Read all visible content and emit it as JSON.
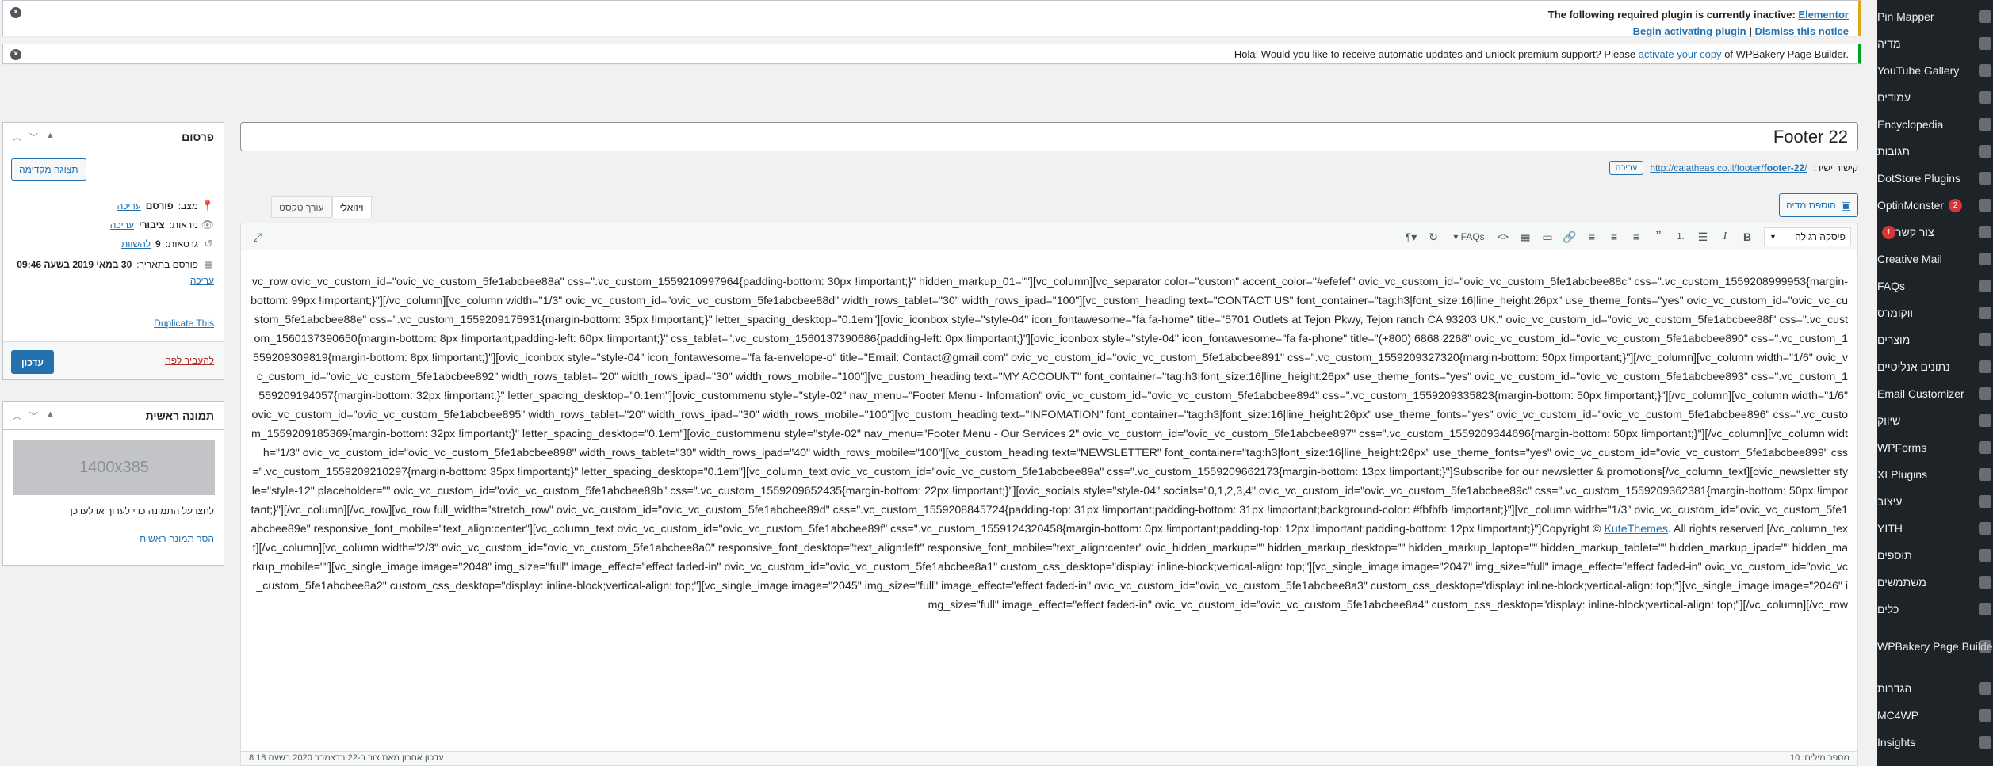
{
  "admin_menu": {
    "items": [
      {
        "label": "Pin Mapper",
        "icon": "pin-icon"
      },
      {
        "label": "מדיה",
        "icon": "media-icon"
      },
      {
        "label": "YouTube Gallery",
        "icon": "youtube-icon"
      },
      {
        "label": "עמודים",
        "icon": "pages-icon"
      },
      {
        "label": "Encyclopedia",
        "icon": "book-icon"
      },
      {
        "label": "תגובות",
        "icon": "comments-icon"
      },
      {
        "label": "DotStore Plugins",
        "icon": "dotstore-icon"
      },
      {
        "label": "OptinMonster",
        "icon": "optinmonster-icon",
        "badge": "2"
      },
      {
        "label": "צור קשר",
        "icon": "contact-icon",
        "badge": "1"
      },
      {
        "label": "Creative Mail",
        "icon": "mail-icon"
      },
      {
        "label": "FAQs",
        "icon": "faq-icon"
      },
      {
        "label": "ווקומרס",
        "icon": "woocommerce-icon"
      },
      {
        "label": "מוצרים",
        "icon": "products-icon"
      },
      {
        "label": "נתונים אנליטיים",
        "icon": "analytics-icon"
      },
      {
        "label": "Email Customizer",
        "icon": "email-customizer-icon"
      },
      {
        "label": "שיווק",
        "icon": "marketing-icon"
      },
      {
        "label": "WPForms",
        "icon": "wpforms-icon"
      },
      {
        "label": "XLPlugins",
        "icon": "xlplugins-icon"
      },
      {
        "label": "עיצוב",
        "icon": "appearance-icon"
      },
      {
        "label": "YITH",
        "icon": "yith-icon"
      },
      {
        "label": "תוספים",
        "icon": "plugins-icon"
      },
      {
        "label": "משתמשים",
        "icon": "users-icon"
      },
      {
        "label": "כלים",
        "icon": "tools-icon"
      },
      {
        "label": "WPBakery Page Builder",
        "icon": "wpbakery-icon"
      },
      {
        "label": "הגדרות",
        "icon": "settings-icon"
      },
      {
        "label": "MC4WP",
        "icon": "mc4wp-icon"
      },
      {
        "label": "Insights",
        "icon": "insights-icon"
      }
    ]
  },
  "notices": {
    "elementor": {
      "text": "The following required plugin is currently inactive:",
      "plugin_link": "Elementor",
      "activate_link": "Begin activating plugin",
      "separator": "|",
      "dismiss_link": "Dismiss this notice"
    },
    "wpbakery": {
      "text_before": "Hola! Would you like to receive automatic updates and unlock premium support? Please",
      "link": "activate your copy",
      "text_after": "of WPBakery Page Builder."
    }
  },
  "post": {
    "title": "Footer 22",
    "permalink_label": "קישור ישיר:",
    "permalink_base": "http://calatheas.co.il/footer/",
    "permalink_slug": "footer-22",
    "permalink_end": "/",
    "permalink_edit": "עריכה"
  },
  "editor": {
    "add_media": "הוספת מדיה",
    "tab_visual": "ויזואלי",
    "tab_text": "עורך טקסט",
    "format_select": "פיסקה רגילה",
    "faq_button": "FAQs",
    "content_main": "vc_row ovic_vc_custom_id=\"ovic_vc_custom_5fe1abcbee88a\" css=\".vc_custom_1559210997964{padding-bottom: 30px !important;}\" hidden_markup_01=\"\"][vc_column][vc_separator color=\"custom\" accent_color=\"#efefef\" ovic_vc_custom_id=\"ovic_vc_custom_5fe1abcbee88c\" css=\".vc_custom_1559208999953{margin-bottom: 99px !important;}\"][/vc_column][vc_column width=\"1/3\" ovic_vc_custom_id=\"ovic_vc_custom_5fe1abcbee88d\" width_rows_tablet=\"30\" width_rows_ipad=\"100\"][vc_custom_heading text=\"CONTACT US\" font_container=\"tag:h3|font_size:16|line_height:26px\" use_theme_fonts=\"yes\" ovic_vc_custom_id=\"ovic_vc_custom_5fe1abcbee88e\" css=\".vc_custom_1559209175931{margin-bottom: 35px !important;}\" letter_spacing_desktop=\"0.1em\"][ovic_iconbox style=\"style-04\" icon_fontawesome=\"fa fa-home\" title=\"5701 Outlets at Tejon Pkwy, Tejon ranch CA 93203 UK.\" ovic_vc_custom_id=\"ovic_vc_custom_5fe1abcbee88f\" css=\".vc_custom_1560137390650{margin-bottom: 8px !important;padding-left: 60px !important;}\" css_tablet=\".vc_custom_1560137390686{padding-left: 0px !important;}\"][ovic_iconbox style=\"style-04\" icon_fontawesome=\"fa fa-phone\" title=\"(+800) 6868 2268\" ovic_vc_custom_id=\"ovic_vc_custom_5fe1abcbee890\" css=\".vc_custom_1559209309819{margin-bottom: 8px !important;}\"][ovic_iconbox style=\"style-04\" icon_fontawesome=\"fa fa-envelope-o\" title=\"Email: Contact@gmail.com\" ovic_vc_custom_id=\"ovic_vc_custom_5fe1abcbee891\" css=\".vc_custom_1559209327320{margin-bottom: 50px !important;}\"][/vc_column][vc_column width=\"1/6\" ovic_vc_custom_id=\"ovic_vc_custom_5fe1abcbee892\" width_rows_tablet=\"20\" width_rows_ipad=\"30\" width_rows_mobile=\"100\"][vc_custom_heading text=\"MY ACCOUNT\" font_container=\"tag:h3|font_size:16|line_height:26px\" use_theme_fonts=\"yes\" ovic_vc_custom_id=\"ovic_vc_custom_5fe1abcbee893\" css=\".vc_custom_1559209194057{margin-bottom: 32px !important;}\" letter_spacing_desktop=\"0.1em\"][ovic_custommenu style=\"style-02\" nav_menu=\"Footer Menu - Infomation\" ovic_vc_custom_id=\"ovic_vc_custom_5fe1abcbee894\" css=\".vc_custom_1559209335823{margin-bottom: 50px !important;}\"][/vc_column][vc_column width=\"1/6\" ovic_vc_custom_id=\"ovic_vc_custom_5fe1abcbee895\" width_rows_tablet=\"20\" width_rows_ipad=\"30\" width_rows_mobile=\"100\"][vc_custom_heading text=\"INFOMATION\" font_container=\"tag:h3|font_size:16|line_height:26px\" use_theme_fonts=\"yes\" ovic_vc_custom_id=\"ovic_vc_custom_5fe1abcbee896\" css=\".vc_custom_1559209185369{margin-bottom: 32px !important;}\" letter_spacing_desktop=\"0.1em\"][ovic_custommenu style=\"style-02\" nav_menu=\"Footer Menu - Our Services 2\" ovic_vc_custom_id=\"ovic_vc_custom_5fe1abcbee897\" css=\".vc_custom_1559209344696{margin-bottom: 50px !important;}\"][/vc_column][vc_column width=\"1/3\" ovic_vc_custom_id=\"ovic_vc_custom_5fe1abcbee898\" width_rows_tablet=\"30\" width_rows_ipad=\"40\" width_rows_mobile=\"100\"][vc_custom_heading text=\"NEWSLETTER\" font_container=\"tag:h3|font_size:16|line_height:26px\" use_theme_fonts=\"yes\" ovic_vc_custom_id=\"ovic_vc_custom_5fe1abcbee899\" css=\".vc_custom_1559209210297{margin-bottom: 35px !important;}\" letter_spacing_desktop=\"0.1em\"][vc_column_text ovic_vc_custom_id=\"ovic_vc_custom_5fe1abcbee89a\" css=\".vc_custom_1559209662173{margin-bottom: 13px !important;}\"]Subscribe for our newsletter & promotions[/vc_column_text][ovic_newsletter style=\"style-12\" placeholder=\"\" ovic_vc_custom_id=\"ovic_vc_custom_5fe1abcbee89b\" css=\".vc_custom_1559209652435{margin-bottom: 22px !important;}\"][ovic_socials style=\"style-04\" socials=\"0,1,2,3,4\" ovic_vc_custom_id=\"ovic_vc_custom_5fe1abcbee89c\" css=\".vc_custom_1559209362381{margin-bottom: 50px !important;}\"][/vc_column][/vc_row][vc_row full_width=\"stretch_row\" ovic_vc_custom_id=\"ovic_vc_custom_5fe1abcbee89d\" css=\".vc_custom_1559208845724{padding-top: 31px !important;padding-bottom: 31px !important;background-color: #fbfbfb !important;}\"][vc_column width=\"1/3\" ovic_vc_custom_id=\"ovic_vc_custom_5fe1abcbee89e\" responsive_font_mobile=\"text_align:center\"][vc_column_text ovic_vc_custom_id=\"ovic_vc_custom_5fe1abcbee89f\" css=\".vc_custom_1559124320458{margin-bottom: 0px !important;padding-top: 12px !important;padding-bottom: 12px !important;}\"]Copyright ©",
    "content_link": "KuteThemes",
    "content_tail": ". All rights reserved.[/vc_column_text][/vc_column][vc_column width=\"2/3\" ovic_vc_custom_id=\"ovic_vc_custom_5fe1abcbee8a0\" responsive_font_desktop=\"text_align:left\" responsive_font_mobile=\"text_align:center\" ovic_hidden_markup=\"\" hidden_markup_desktop=\"\" hidden_markup_laptop=\"\" hidden_markup_tablet=\"\" hidden_markup_ipad=\"\" hidden_markup_mobile=\"\"][vc_single_image image=\"2048\" img_size=\"full\" image_effect=\"effect faded-in\" ovic_vc_custom_id=\"ovic_vc_custom_5fe1abcbee8a1\" custom_css_desktop=\"display: inline-block;vertical-align: top;\"][vc_single_image image=\"2047\" img_size=\"full\" image_effect=\"effect faded-in\" ovic_vc_custom_id=\"ovic_vc_custom_5fe1abcbee8a2\" custom_css_desktop=\"display: inline-block;vertical-align: top;\"][vc_single_image image=\"2045\" img_size=\"full\" image_effect=\"effect faded-in\" ovic_vc_custom_id=\"ovic_vc_custom_5fe1abcbee8a3\" custom_css_desktop=\"display: inline-block;vertical-align: top;\"][vc_single_image image=\"2046\" img_size=\"full\" image_effect=\"effect faded-in\" ovic_vc_custom_id=\"ovic_vc_custom_5fe1abcbee8a4\" custom_css_desktop=\"display: inline-block;vertical-align: top;\"][/vc_column][/vc_row",
    "word_count": "מספר מילים: 10",
    "last_edited": "עדכון אחרון מאת צור ב-22 בדצמבר 2020 בשעה 8:18"
  },
  "publish_box": {
    "title": "פרסום",
    "preview_button": "תצוגה מקדימה",
    "status_label": "מצב:",
    "status_value": "פורסם",
    "status_edit": "עריכה",
    "visibility_label": "ניראות:",
    "visibility_value": "ציבורי",
    "visibility_edit": "עריכה",
    "revisions_label": "גרסאות:",
    "revisions_value": "9",
    "revisions_link": "להשוות",
    "published_label": "פורסם בתאריך:",
    "published_value": "30 במאי 2019 בשעה 09:46",
    "published_edit": "עריכה",
    "duplicate_link": "Duplicate This",
    "trash_link": "להעביר לפח",
    "update_button": "עדכון"
  },
  "featured_box": {
    "title": "תמונה ראשית",
    "placeholder": "1400x385",
    "hint": "לחצו על התמונה כדי לערוך או לעדכן",
    "remove_link": "הסר תמונה ראשית"
  },
  "colors": {
    "admin_bg": "#1d2327",
    "link": "#2271b1",
    "warning_border": "#dba617",
    "success_border": "#00a32a",
    "badge": "#d63638"
  }
}
